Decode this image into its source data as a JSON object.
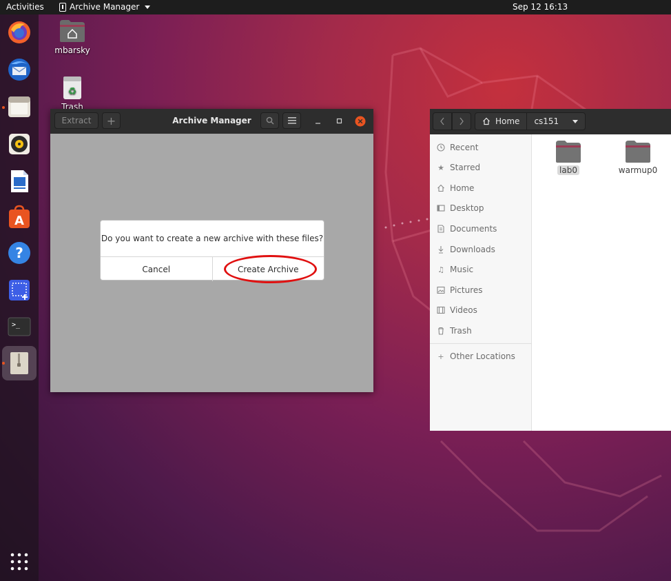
{
  "topbar": {
    "activities": "Activities",
    "app_name": "Archive Manager",
    "clock": "Sep 12  16:13"
  },
  "dock": {
    "items": [
      {
        "name": "firefox-icon"
      },
      {
        "name": "thunderbird-icon"
      },
      {
        "name": "files-icon"
      },
      {
        "name": "rhythmbox-icon"
      },
      {
        "name": "writer-icon"
      },
      {
        "name": "software-icon"
      },
      {
        "name": "help-icon"
      },
      {
        "name": "screenshot-icon"
      },
      {
        "name": "terminal-icon"
      },
      {
        "name": "archive-manager-icon"
      },
      {
        "name": "show-apps-icon"
      }
    ]
  },
  "desktop_icons": {
    "home": "mbarsky",
    "trash": "Trash"
  },
  "archive_window": {
    "extract_label": "Extract",
    "add_label": "+",
    "title": "Archive Manager"
  },
  "dialog": {
    "message": "Do you want to create a new archive with these files?",
    "cancel": "Cancel",
    "create": "Create Archive"
  },
  "files_window": {
    "breadcrumbs": [
      "Home",
      "cs151"
    ],
    "sidebar": [
      {
        "label": "Recent",
        "icon": "clock-icon"
      },
      {
        "label": "Starred",
        "icon": "star-icon"
      },
      {
        "label": "Home",
        "icon": "home-icon"
      },
      {
        "label": "Desktop",
        "icon": "desktop-icon"
      },
      {
        "label": "Documents",
        "icon": "document-icon"
      },
      {
        "label": "Downloads",
        "icon": "download-icon"
      },
      {
        "label": "Music",
        "icon": "music-icon"
      },
      {
        "label": "Pictures",
        "icon": "picture-icon"
      },
      {
        "label": "Videos",
        "icon": "video-icon"
      },
      {
        "label": "Trash",
        "icon": "trash-icon"
      }
    ],
    "other_locations": "Other Locations",
    "folders": [
      "lab0",
      "warmup0"
    ]
  },
  "colors": {
    "accent": "#e95420",
    "highlight": "#e01010",
    "folder": "#737373"
  }
}
